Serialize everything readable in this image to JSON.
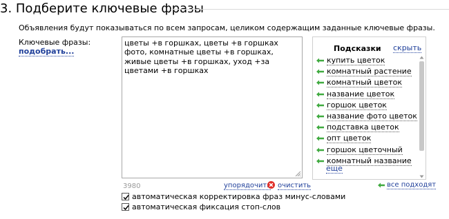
{
  "section": {
    "title": "3. Подберите ключевые фразы",
    "description": "Объявления будут показываться по всем запросам, целиком содержащим заданные ключевые фразы."
  },
  "keywords": {
    "label": "Ключевые фразы:",
    "pick_link": "подобрать...",
    "text": "цветы +в горшках, цветы +в горшках фото, комнатные цветы +в горшках, живые цветы +в горшках, уход +за цветами +в горшках",
    "counter": "3980",
    "sort_link": "упорядочить",
    "clear_link": "очистить"
  },
  "suggestions": {
    "title": "Подсказки",
    "hide_link": "скрыть",
    "items": [
      "купить цветок",
      "комнатный растение",
      "комнатный цветок",
      "название цветок",
      "горшок цветок",
      "название фото цветок",
      "подставка цветок",
      "опт цветок",
      "горшок цветочный",
      "комнатный название"
    ],
    "more_link": "еще",
    "all_fit_link": "все подходят"
  },
  "options": {
    "autocorrect_label": "автоматическая корректировка фраз минус-словами",
    "autocorrect_checked": true,
    "stopwords_label": "автоматическая фиксация стоп-слов",
    "stopwords_checked": true
  },
  "colors": {
    "link": "#1f3f9a",
    "arrow": "#3faa3f",
    "clear_icon": "#e0302a"
  }
}
